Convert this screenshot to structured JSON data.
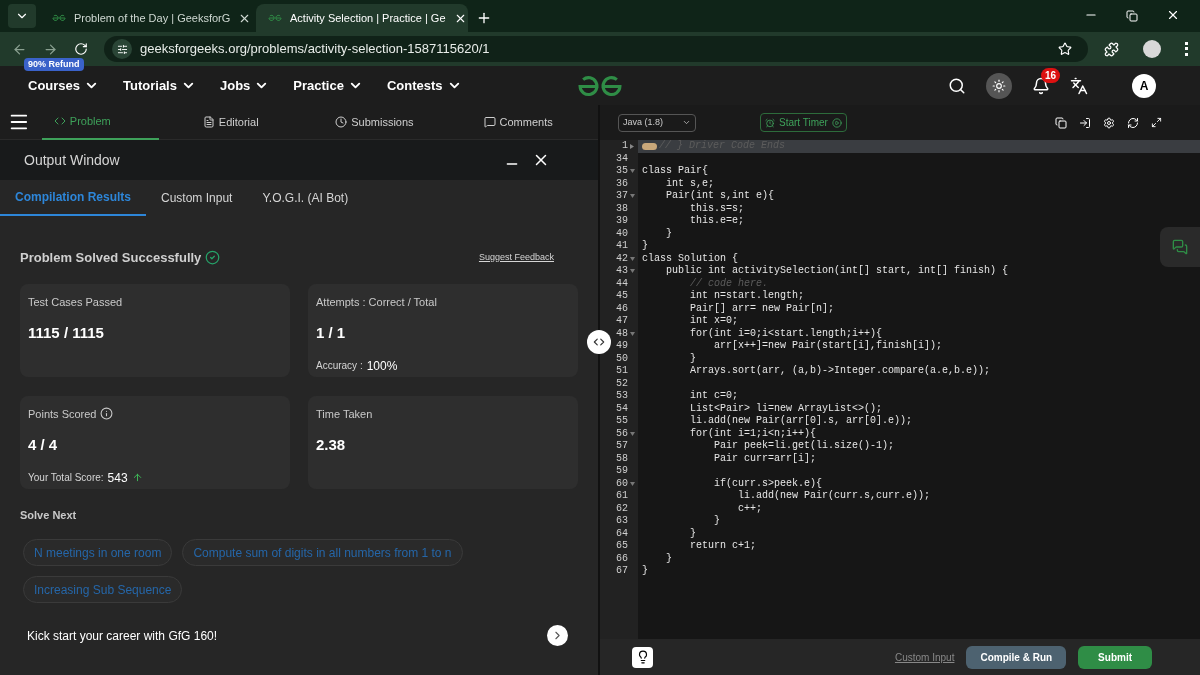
{
  "browser": {
    "tabs": [
      {
        "title": "Problem of the Day | GeeksforG",
        "selected": false
      },
      {
        "title": "Activity Selection | Practice | Ge",
        "selected": true
      }
    ],
    "url": "geeksforgeeks.org/problems/activity-selection-1587115620/1"
  },
  "nav": {
    "items": [
      {
        "label": "Courses",
        "badge": "90% Refund"
      },
      {
        "label": "Tutorials"
      },
      {
        "label": "Jobs"
      },
      {
        "label": "Practice"
      },
      {
        "label": "Contests"
      }
    ],
    "notifications": "16",
    "avatar": "A"
  },
  "problem_tabs": [
    {
      "label": "Problem",
      "selected": true,
      "kind": "code"
    },
    {
      "label": "Editorial",
      "selected": false,
      "kind": "doc"
    },
    {
      "label": "Submissions",
      "selected": false,
      "kind": "clock"
    },
    {
      "label": "Comments",
      "selected": false,
      "kind": "chat"
    }
  ],
  "output": {
    "title": "Output Window",
    "tabs": [
      {
        "label": "Compilation Results",
        "selected": true
      },
      {
        "label": "Custom Input",
        "selected": false
      },
      {
        "label": "Y.O.G.I. (AI Bot)",
        "selected": false
      }
    ],
    "status": "Problem Solved Successfully",
    "feedback": "Suggest Feedback",
    "cards": [
      {
        "label": "Test Cases Passed",
        "value": "1115 / 1115"
      },
      {
        "label": "Attempts : Correct / Total",
        "value": "1 / 1",
        "note_label": "Accuracy :",
        "note_value": "100%"
      },
      {
        "label": "Points Scored",
        "value": "4 / 4",
        "info": true,
        "note_label": "Your Total Score:",
        "note_value": "543",
        "trend_up": true
      },
      {
        "label": "Time Taken",
        "value": "2.38"
      }
    ],
    "solve_next_title": "Solve Next",
    "solve_next": [
      "N meetings in one room",
      "Compute sum of digits in all numbers from 1 to n",
      "Increasing Sub Sequence"
    ],
    "promo": "Kick start your career with GfG 160!"
  },
  "editor": {
    "language": "Java (1.8)",
    "timer": "Start Timer",
    "lines": [
      {
        "n": "1",
        "text": "// } Driver Code Ends",
        "kind": "comment",
        "expanded": false,
        "highlight": true
      },
      {
        "n": "34",
        "kind": "blank"
      },
      {
        "n": "35",
        "text": "class Pair{",
        "kind": "code",
        "expanded": true
      },
      {
        "n": "36",
        "text": "    int s,e;",
        "kind": "code"
      },
      {
        "n": "37",
        "text": "    Pair(int s,int e){",
        "kind": "code",
        "expanded": true
      },
      {
        "n": "38",
        "text": "        this.s=s;",
        "kind": "code"
      },
      {
        "n": "39",
        "text": "        this.e=e;",
        "kind": "code"
      },
      {
        "n": "40",
        "text": "    }",
        "kind": "code"
      },
      {
        "n": "41",
        "text": "}",
        "kind": "code"
      },
      {
        "n": "42",
        "text": "class Solution {",
        "kind": "code",
        "expanded": true
      },
      {
        "n": "43",
        "text": "    public int activitySelection(int[] start, int[] finish) {",
        "kind": "code",
        "expanded": true
      },
      {
        "n": "44",
        "text": "        // code here.",
        "kind": "comment"
      },
      {
        "n": "45",
        "text": "        int n=start.length;",
        "kind": "code"
      },
      {
        "n": "46",
        "text": "        Pair[] arr= new Pair[n];",
        "kind": "code"
      },
      {
        "n": "47",
        "text": "        int x=0;",
        "kind": "code"
      },
      {
        "n": "48",
        "text": "        for(int i=0;i<start.length;i++){",
        "kind": "code",
        "expanded": true
      },
      {
        "n": "49",
        "text": "            arr[x++]=new Pair(start[i],finish[i]);",
        "kind": "code"
      },
      {
        "n": "50",
        "text": "        }",
        "kind": "code"
      },
      {
        "n": "51",
        "text": "        Arrays.sort(arr, (a,b)->Integer.compare(a.e,b.e));",
        "kind": "code"
      },
      {
        "n": "52",
        "kind": "blank"
      },
      {
        "n": "53",
        "text": "        int c=0;",
        "kind": "code"
      },
      {
        "n": "54",
        "text": "        List<Pair> li=new ArrayList<>();",
        "kind": "code"
      },
      {
        "n": "55",
        "text": "        li.add(new Pair(arr[0].s, arr[0].e));",
        "kind": "code"
      },
      {
        "n": "56",
        "text": "        for(int i=1;i<n;i++){",
        "kind": "code",
        "expanded": true
      },
      {
        "n": "57",
        "text": "            Pair peek=li.get(li.size()-1);",
        "kind": "code"
      },
      {
        "n": "58",
        "text": "            Pair curr=arr[i];",
        "kind": "code"
      },
      {
        "n": "59",
        "kind": "blank"
      },
      {
        "n": "60",
        "text": "            if(curr.s>peek.e){",
        "kind": "code",
        "expanded": true
      },
      {
        "n": "61",
        "text": "                li.add(new Pair(curr.s,curr.e));",
        "kind": "code"
      },
      {
        "n": "62",
        "text": "                c++;",
        "kind": "code"
      },
      {
        "n": "63",
        "text": "            }",
        "kind": "code"
      },
      {
        "n": "64",
        "text": "        }",
        "kind": "code"
      },
      {
        "n": "65",
        "text": "        return c+1;",
        "kind": "code"
      },
      {
        "n": "66",
        "text": "    }",
        "kind": "code"
      },
      {
        "n": "67",
        "text": "}",
        "kind": "code"
      }
    ],
    "custom_input": "Custom Input",
    "compile": "Compile & Run",
    "submit": "Submit"
  }
}
